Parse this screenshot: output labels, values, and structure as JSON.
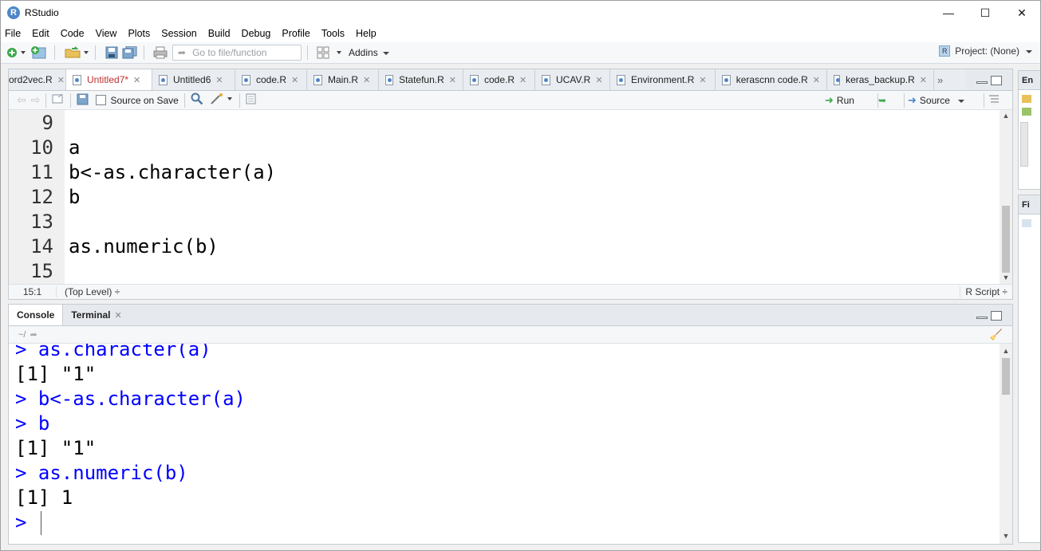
{
  "window": {
    "title": "RStudio",
    "min": "—",
    "max": "☐",
    "close": "✕"
  },
  "menu": [
    "File",
    "Edit",
    "Code",
    "View",
    "Plots",
    "Session",
    "Build",
    "Debug",
    "Profile",
    "Tools",
    "Help"
  ],
  "toolbar": {
    "goto_placeholder": "Go to file/function",
    "addins": "Addins",
    "project": "Project: (None)"
  },
  "source_tabs": [
    {
      "label": "ord2vec.R",
      "active": false
    },
    {
      "label": "Untitled7*",
      "active": true
    },
    {
      "label": "Untitled6",
      "active": false
    },
    {
      "label": "code.R",
      "active": false
    },
    {
      "label": "Main.R",
      "active": false
    },
    {
      "label": "Statefun.R",
      "active": false
    },
    {
      "label": "code.R",
      "active": false
    },
    {
      "label": "UCAV.R",
      "active": false
    },
    {
      "label": "Environment.R",
      "active": false
    },
    {
      "label": "kerascnn code.R",
      "active": false
    },
    {
      "label": "keras_backup.R",
      "active": false
    }
  ],
  "editor_toolbar": {
    "source_on_save": "Source on Save",
    "run": "Run",
    "source": "Source"
  },
  "editor_lines": [
    {
      "num": "9",
      "code": ""
    },
    {
      "num": "10",
      "code": "a"
    },
    {
      "num": "11",
      "code": "b<-as.character(a)"
    },
    {
      "num": "12",
      "code": "b"
    },
    {
      "num": "13",
      "code": ""
    },
    {
      "num": "14",
      "code": "as.numeric(b)"
    },
    {
      "num": "15",
      "code": ""
    }
  ],
  "status": {
    "position": "15:1",
    "scope": "(Top Level) ÷",
    "filetype": "R Script ÷"
  },
  "console_tabs": {
    "console": "Console",
    "terminal": "Terminal"
  },
  "console_path": "~/",
  "console_lines": [
    {
      "type": "in",
      "text": "> as.character(a)"
    },
    {
      "type": "out",
      "text": "[1] \"1\""
    },
    {
      "type": "in",
      "text": "> b<-as.character(a)"
    },
    {
      "type": "in",
      "text": "> b"
    },
    {
      "type": "out",
      "text": "[1] \"1\""
    },
    {
      "type": "in",
      "text": "> as.numeric(b)"
    },
    {
      "type": "out",
      "text": "[1] 1"
    },
    {
      "type": "in",
      "text": "> "
    }
  ],
  "right_strip": {
    "top_label": "En",
    "bottom_label": "Fi"
  }
}
